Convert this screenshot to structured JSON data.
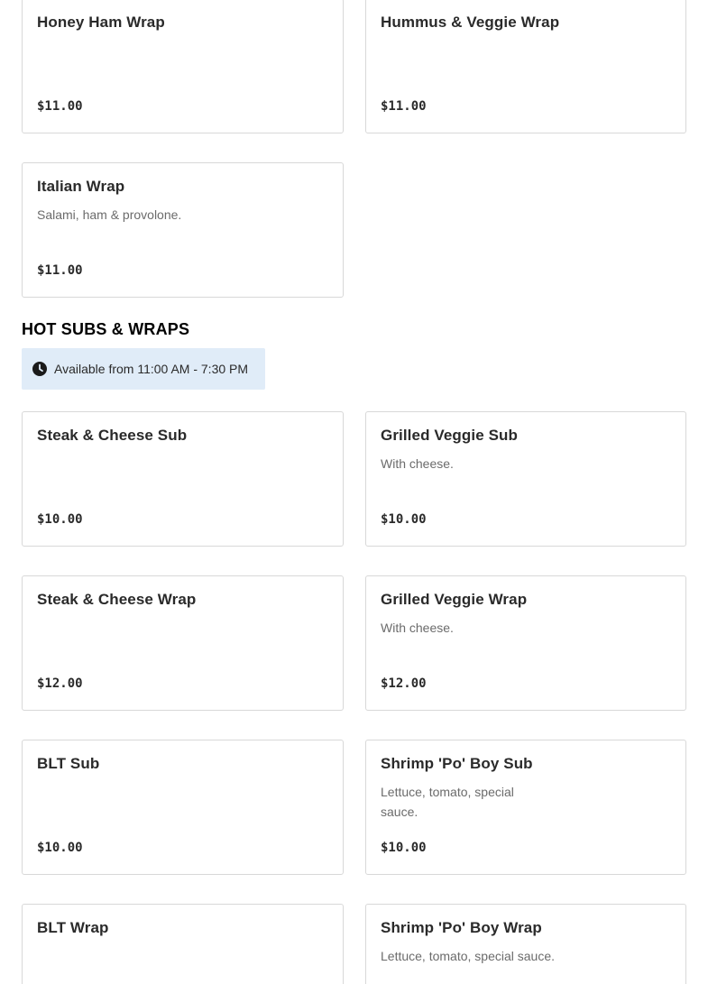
{
  "wraps_top": [
    {
      "name": "Honey Ham Wrap",
      "description": "",
      "price": "$11.00"
    },
    {
      "name": "Hummus & Veggie Wrap",
      "description": "",
      "price": "$11.00"
    },
    {
      "name": "Italian Wrap",
      "description": "Salami, ham & provolone.",
      "price": "$11.00"
    }
  ],
  "hot_section": {
    "title": "HOT SUBS & WRAPS",
    "availability": "Available from 11:00 AM - 7:30 PM",
    "icon": "clock-icon",
    "items": [
      {
        "name": "Steak & Cheese Sub",
        "description": "",
        "price": "$10.00"
      },
      {
        "name": "Grilled Veggie Sub",
        "description": "With cheese.",
        "price": "$10.00"
      },
      {
        "name": "Steak & Cheese Wrap",
        "description": "",
        "price": "$12.00"
      },
      {
        "name": "Grilled Veggie Wrap",
        "description": "With cheese.",
        "price": "$12.00"
      },
      {
        "name": "BLT Sub",
        "description": "",
        "price": "$10.00"
      },
      {
        "name": "Shrimp 'Po' Boy Sub",
        "description": "Lettuce, tomato, special sauce.",
        "price": "$10.00"
      },
      {
        "name": "BLT Wrap",
        "description": "",
        "price": ""
      },
      {
        "name": "Shrimp 'Po' Boy Wrap",
        "description": "Lettuce, tomato, special sauce.",
        "price": ""
      }
    ]
  },
  "colors": {
    "availability_bg": "#e0ecf8",
    "border": "#d8d8d8",
    "description_text": "#6b6b6b"
  }
}
